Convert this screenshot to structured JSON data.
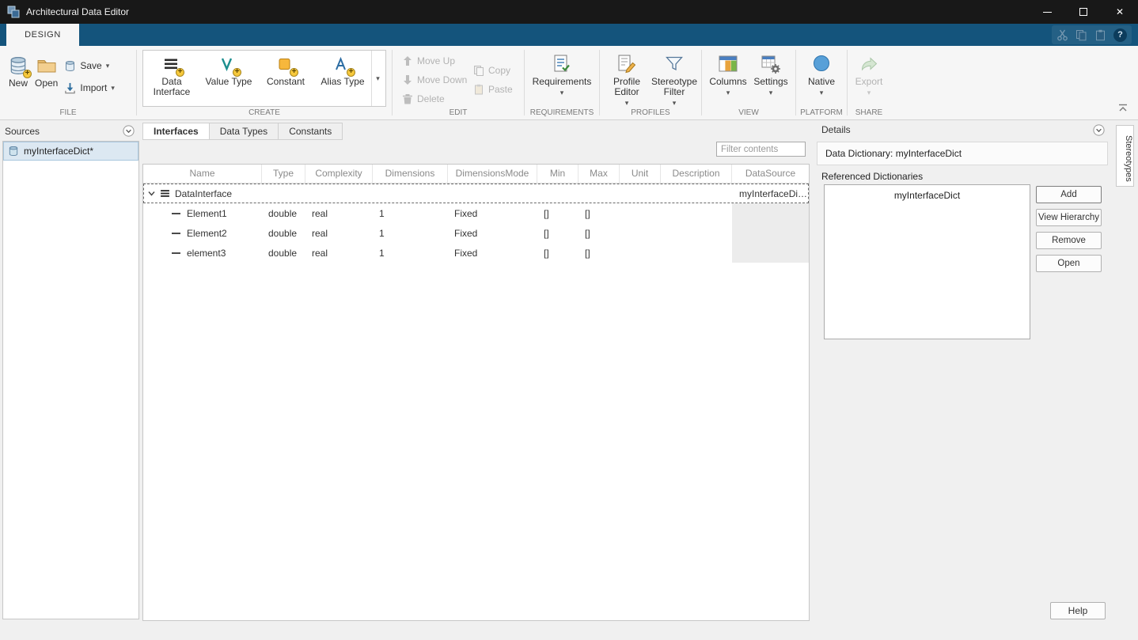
{
  "window": {
    "title": "Architectural Data Editor"
  },
  "ribbon": {
    "tab": "DESIGN",
    "help": "?",
    "file": {
      "label": "FILE",
      "new": "New",
      "open": "Open",
      "save": "Save",
      "import": "Import"
    },
    "create": {
      "label": "CREATE",
      "items": [
        {
          "label": "Data Interface"
        },
        {
          "label": "Value Type"
        },
        {
          "label": "Constant"
        },
        {
          "label": "Alias Type"
        }
      ]
    },
    "edit": {
      "label": "EDIT",
      "move_up": "Move Up",
      "move_down": "Move Down",
      "delete": "Delete",
      "copy": "Copy",
      "paste": "Paste"
    },
    "requirements": {
      "label": "REQUIREMENTS",
      "button": "Requirements"
    },
    "profiles": {
      "label": "PROFILES",
      "profile_editor": "Profile Editor",
      "stereotype_filter": "Stereotype Filter"
    },
    "view": {
      "label": "VIEW",
      "columns": "Columns",
      "settings": "Settings"
    },
    "platform": {
      "label": "PLATFORM",
      "native": "Native"
    },
    "share": {
      "label": "SHARE",
      "export": "Export"
    }
  },
  "sources": {
    "title": "Sources",
    "items": [
      {
        "label": "myInterfaceDict*"
      }
    ]
  },
  "content": {
    "tabs": [
      {
        "label": "Interfaces"
      },
      {
        "label": "Data Types"
      },
      {
        "label": "Constants"
      }
    ],
    "filter_placeholder": "Filter contents",
    "table": {
      "columns": [
        "Name",
        "Type",
        "Complexity",
        "Dimensions",
        "DimensionsMode",
        "Min",
        "Max",
        "Unit",
        "Description",
        "DataSource"
      ],
      "rows": [
        {
          "name": "DataInterface",
          "type": "",
          "complexity": "",
          "dimensions": "",
          "dimensions_mode": "",
          "min": "",
          "max": "",
          "unit": "",
          "description": "",
          "data_source": "myInterfaceDic..."
        },
        {
          "name": "Element1",
          "type": "double",
          "complexity": "real",
          "dimensions": "1",
          "dimensions_mode": "Fixed",
          "min": "[]",
          "max": "[]",
          "unit": "",
          "description": "",
          "data_source": ""
        },
        {
          "name": "Element2",
          "type": "double",
          "complexity": "real",
          "dimensions": "1",
          "dimensions_mode": "Fixed",
          "min": "[]",
          "max": "[]",
          "unit": "",
          "description": "",
          "data_source": ""
        },
        {
          "name": "element3",
          "type": "double",
          "complexity": "real",
          "dimensions": "1",
          "dimensions_mode": "Fixed",
          "min": "[]",
          "max": "[]",
          "unit": "",
          "description": "",
          "data_source": ""
        }
      ]
    }
  },
  "details": {
    "title": "Details",
    "dictionary_header": "Data Dictionary: myInterfaceDict",
    "referenced_label": "Referenced Dictionaries",
    "referenced_items": [
      {
        "label": "myInterfaceDict"
      }
    ],
    "buttons": [
      {
        "label": "Add"
      },
      {
        "label": "View Hierarchy"
      },
      {
        "label": "Remove"
      },
      {
        "label": "Open"
      }
    ],
    "help": "Help"
  },
  "rail": {
    "stereotypes": "Stereotypes"
  }
}
